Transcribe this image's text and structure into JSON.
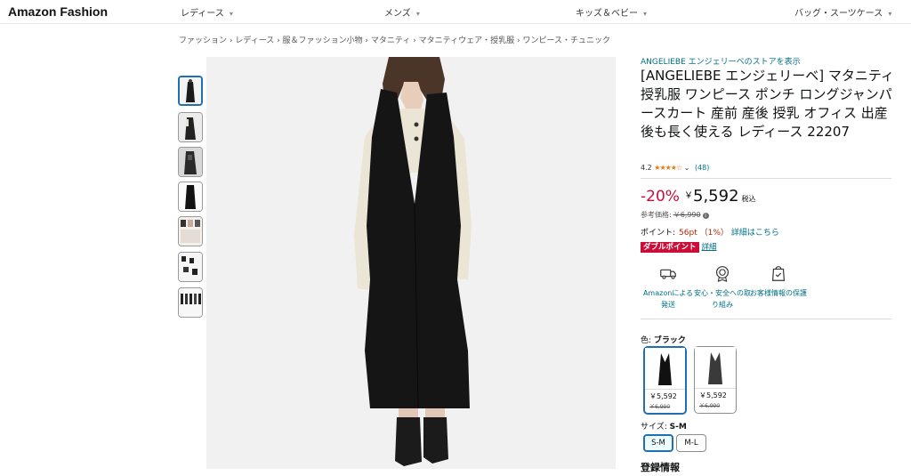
{
  "header": {
    "brand": "Amazon Fashion",
    "nav": [
      "レディース",
      "メンズ",
      "キッズ＆ベビー",
      "バッグ・スーツケース"
    ]
  },
  "breadcrumb": [
    "ファッション",
    "レディース",
    "服＆ファッション小物",
    "マタニティ",
    "マタニティウェア・授乳服",
    "ワンピース・チュニック"
  ],
  "breadcrumb_text": "ファッション › レディース › 服＆ファッション小物 › マタニティ › マタニティウェア・授乳服 › ワンピース・チュニック",
  "product": {
    "store_link": "ANGELIEBE エンジェリーベのストアを表示",
    "title": "[ANGELIEBE エンジェリーベ] マタニティ 授乳服 ワンピース ポンチ ロングジャンパースカート 産前 産後 授乳 オフィス 出産後も長く使える レディース 22207",
    "rating_value": "4.2",
    "rating_stars": "★★★★☆",
    "rating_count": "(48)",
    "discount": "-20%",
    "price_symbol": "￥",
    "price": "5,592",
    "tax_label": "税込",
    "ref_label": "参考価格:",
    "ref_price": "￥6,990",
    "points_label": "ポイント:",
    "points_value": "56pt （1%）",
    "points_link": "詳細はこちら",
    "double_badge": "ダブルポイント",
    "double_link": "詳細",
    "features": [
      {
        "icon": "truck-icon",
        "label": "Amazonによる発送"
      },
      {
        "icon": "badge-icon",
        "label": "安心・安全への取り組み"
      },
      {
        "icon": "shield-bag-icon",
        "label": "お客様情報の保護"
      }
    ],
    "color_label": "色:",
    "color_value": "ブラック",
    "colors": [
      {
        "name": "black",
        "price": "￥5,592",
        "orig": "￥6,990"
      },
      {
        "name": "charcoal",
        "price": "￥5,592",
        "orig": "￥6,990"
      }
    ],
    "size_label": "サイズ:",
    "size_value": "S-M",
    "sizes": [
      "S-M",
      "M-L"
    ],
    "registration": "登録情報"
  },
  "colors": {
    "link": "#007185",
    "deal": "#cc0c39",
    "selected": "#1f6fb2"
  }
}
